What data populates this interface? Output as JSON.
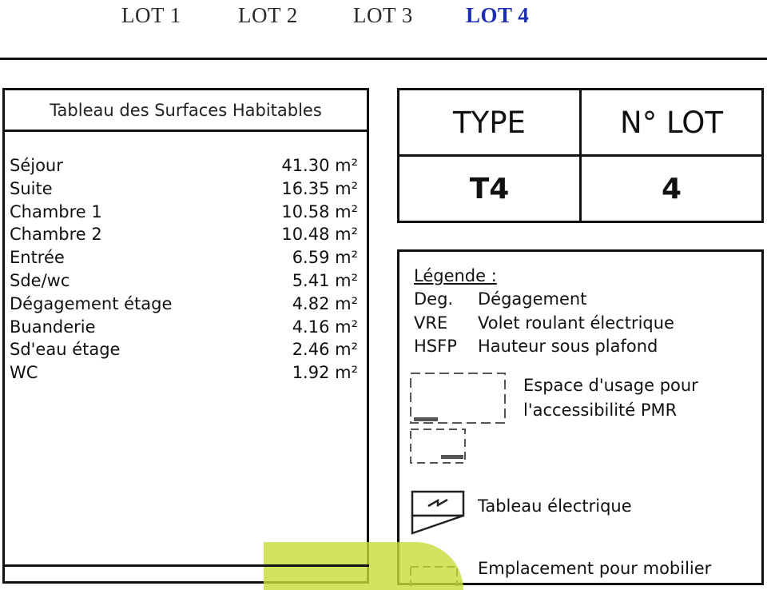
{
  "tabs": [
    {
      "label": "LOT 1",
      "active": false
    },
    {
      "label": "LOT 2",
      "active": false
    },
    {
      "label": "LOT 3",
      "active": false
    },
    {
      "label": "LOT 4",
      "active": true
    }
  ],
  "colors": {
    "active_tab": "#1d2fb0",
    "highlight": "#c6dc3a",
    "border": "#111111"
  },
  "surfaces": {
    "title": "Tableau des Surfaces Habitables",
    "rows": [
      {
        "name": "Séjour",
        "area": "41.30 m²"
      },
      {
        "name": "Suite",
        "area": "16.35 m²"
      },
      {
        "name": "Chambre 1",
        "area": "10.58 m²"
      },
      {
        "name": "Chambre 2",
        "area": "10.48 m²"
      },
      {
        "name": "Entrée",
        "area": "6.59 m²"
      },
      {
        "name": "Sde/wc",
        "area": "5.41 m²"
      },
      {
        "name": "Dégagement étage",
        "area": "4.82 m²"
      },
      {
        "name": "Buanderie",
        "area": "4.16 m²"
      },
      {
        "name": "Sd'eau étage",
        "area": "2.46 m²"
      },
      {
        "name": "WC",
        "area": "1.92 m²"
      }
    ]
  },
  "type_table": {
    "type_header": "TYPE",
    "lot_header": "N° LOT",
    "type_value": "T4",
    "lot_value": "4"
  },
  "legend": {
    "title": "Légende :",
    "abbreviations": [
      {
        "abbr": "Deg.",
        "meaning": "Dégagement"
      },
      {
        "abbr": "VRE",
        "meaning": "Volet roulant électrique"
      },
      {
        "abbr": "HSFP",
        "meaning": "Hauteur sous plafond"
      }
    ],
    "symbols": {
      "pmr_line1": "Espace d'usage pour",
      "pmr_line2": "l'accessibilité PMR",
      "panel": "Tableau électrique",
      "furniture": "Emplacement pour mobilier",
      "icons": [
        "pmr-space-icon",
        "electrical-panel-icon",
        "furniture-icon"
      ]
    }
  }
}
